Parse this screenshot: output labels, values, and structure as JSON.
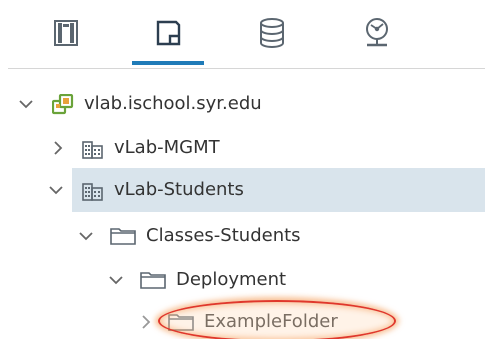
{
  "tabs": [
    {
      "icon": "hosts-clusters-icon",
      "selected": false
    },
    {
      "icon": "vms-templates-icon",
      "selected": true
    },
    {
      "icon": "storage-icon",
      "selected": false
    },
    {
      "icon": "networking-icon",
      "selected": false
    }
  ],
  "tree": {
    "root": {
      "label": "vlab.ischool.syr.edu",
      "icon": "vcenter-icon",
      "expanded": true
    },
    "datacenter_mgmt": {
      "label": "vLab-MGMT",
      "icon": "datacenter-icon",
      "expanded": false
    },
    "datacenter_students": {
      "label": "vLab-Students",
      "icon": "datacenter-icon",
      "expanded": true,
      "selected": true
    },
    "folder_classes": {
      "label": "Classes-Students",
      "icon": "folder-icon",
      "expanded": true
    },
    "folder_deployment": {
      "label": "Deployment",
      "icon": "folder-icon",
      "expanded": true
    },
    "folder_example": {
      "label": "ExampleFolder",
      "icon": "folder-icon",
      "expanded": false,
      "highlighted": true
    }
  },
  "colors": {
    "accent": "#1f7bb8",
    "selection": "#d9e4ec",
    "vcenter_green": "#6aa33a",
    "vcenter_orange": "#e8a23b",
    "highlight_red": "#e0382b",
    "text": "#333333"
  }
}
